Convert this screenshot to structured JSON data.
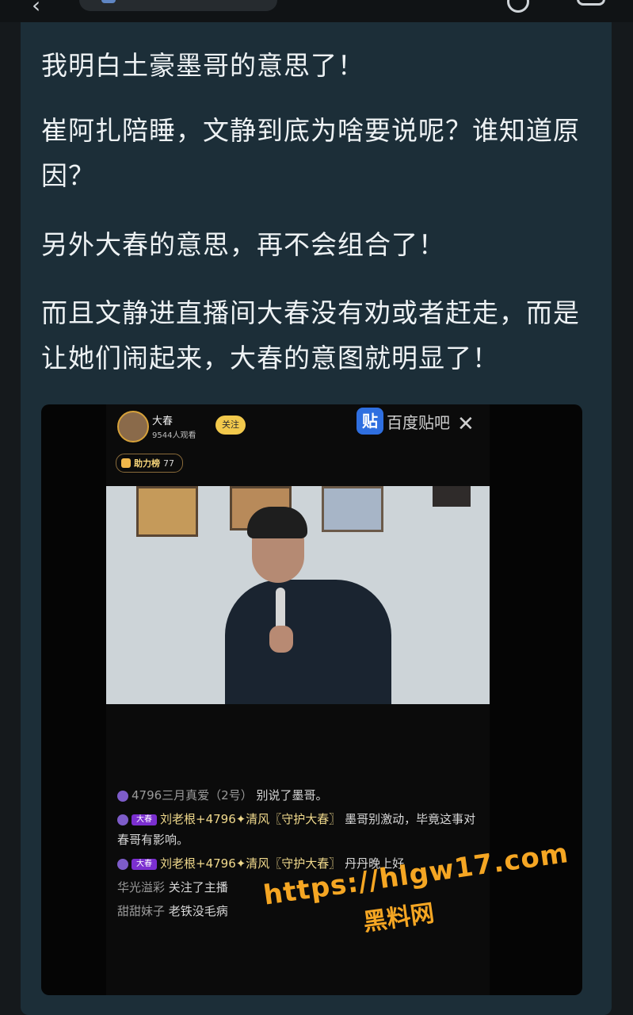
{
  "header": {
    "back_icon": "chevron-left-icon",
    "search_icon": "search-icon",
    "more_icon": "more-icon"
  },
  "post": {
    "paragraphs": [
      "我明白土豪墨哥的意思了！",
      "崔阿扎陪睡，文静到底为啥要说呢？谁知道原因？",
      "另外大春的意思，再不会组合了！",
      "而且文静进直播间大春没有劝或者赶走，而是让她们闹起来，大春的意图就明显了！"
    ]
  },
  "screenshot": {
    "streamer_name": "大春",
    "viewers": "9544人观看",
    "follow_label": "关注",
    "rank_label": "助力榜",
    "rank_value": "77",
    "source_logo_char": "贴",
    "source_name": "百度贴吧",
    "close_icon": "close-icon",
    "chat": [
      {
        "user": "4796三月真爱（2号）",
        "text": "别说了墨哥。"
      },
      {
        "tag": "大春",
        "user": "刘老根+4796✦清风〖守护大春〗",
        "text": "墨哥别激动，毕竟这事对春哥有影响。"
      },
      {
        "tag": "大春",
        "user": "刘老根+4796✦清风〖守护大春〗",
        "text": "丹丹晚上好"
      },
      {
        "user": "华光溢彩",
        "text": "关注了主播"
      },
      {
        "user": "甜甜妹子",
        "text": "老铁没毛病"
      }
    ],
    "watermark_url": "https://hlgw17.com",
    "watermark_text": "黑料网"
  }
}
